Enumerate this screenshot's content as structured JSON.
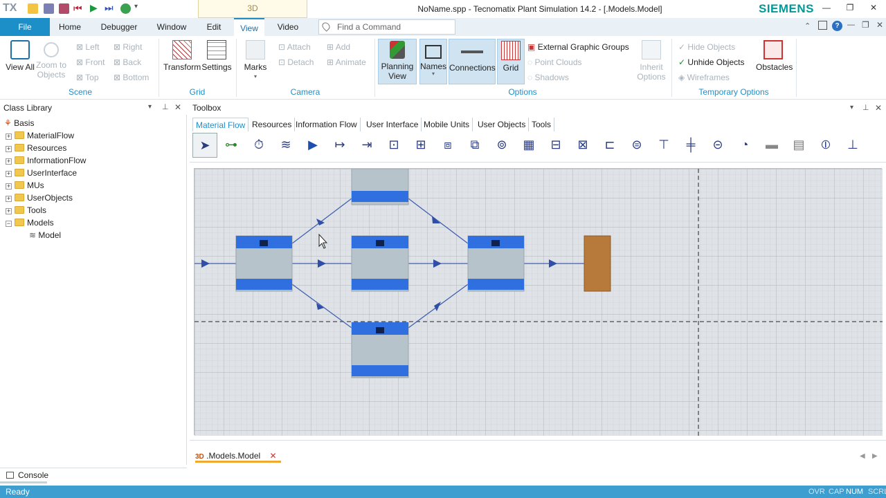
{
  "app": {
    "logo": "TX",
    "tab_3d": "3D",
    "window_title": "NoName.spp - Tecnomatix Plant Simulation 14.2 - [.Models.Model]",
    "brand": "SIEMENS",
    "brand_color": "#009999"
  },
  "menu": {
    "tabs": [
      "File",
      "Home",
      "Debugger",
      "Window",
      "Edit",
      "View",
      "Video"
    ],
    "active_tab": "View",
    "find_placeholder": "Find a Command"
  },
  "ribbon": {
    "scene": {
      "label": "Scene",
      "view_all": "View All",
      "zoom_to_objects": "Zoom to Objects",
      "left": "Left",
      "right": "Right",
      "front": "Front",
      "back": "Back",
      "top": "Top",
      "bottom": "Bottom"
    },
    "grid": {
      "label": "Grid",
      "transform": "Transform",
      "settings": "Settings"
    },
    "camera": {
      "label": "Camera",
      "marks": "Marks",
      "attach": "Attach",
      "detach": "Detach",
      "add": "Add",
      "animate": "Animate"
    },
    "options": {
      "label": "Options",
      "planning_view": "Planning View",
      "names": "Names",
      "connections": "Connections",
      "grid": "Grid",
      "external_graphic_groups": "External Graphic Groups",
      "point_clouds": "Point Clouds",
      "shadows": "Shadows",
      "inherit_options": "Inherit Options"
    },
    "temporary": {
      "label": "Temporary Options",
      "hide_objects": "Hide Objects",
      "unhide_objects": "Unhide Objects",
      "wireframes": "Wireframes",
      "obstacles": "Obstacles"
    }
  },
  "class_library": {
    "title": "Class Library",
    "root": "Basis",
    "items": [
      "MaterialFlow",
      "Resources",
      "InformationFlow",
      "UserInterface",
      "MUs",
      "UserObjects",
      "Tools",
      "Models"
    ],
    "child": "Model"
  },
  "toolbox": {
    "title": "Toolbox",
    "tabs": [
      "Material Flow",
      "Resources",
      "Information Flow",
      "User Interface",
      "Mobile Units",
      "User Objects",
      "Tools"
    ],
    "active_tab": "Material Flow"
  },
  "document_tab": {
    "prefix": "3D",
    "label": ".Models.Model"
  },
  "console": "Console",
  "status": {
    "text": "Ready",
    "indicators": [
      "OVR",
      "CAP",
      "NUM",
      "SCRL"
    ],
    "active": "NUM"
  }
}
